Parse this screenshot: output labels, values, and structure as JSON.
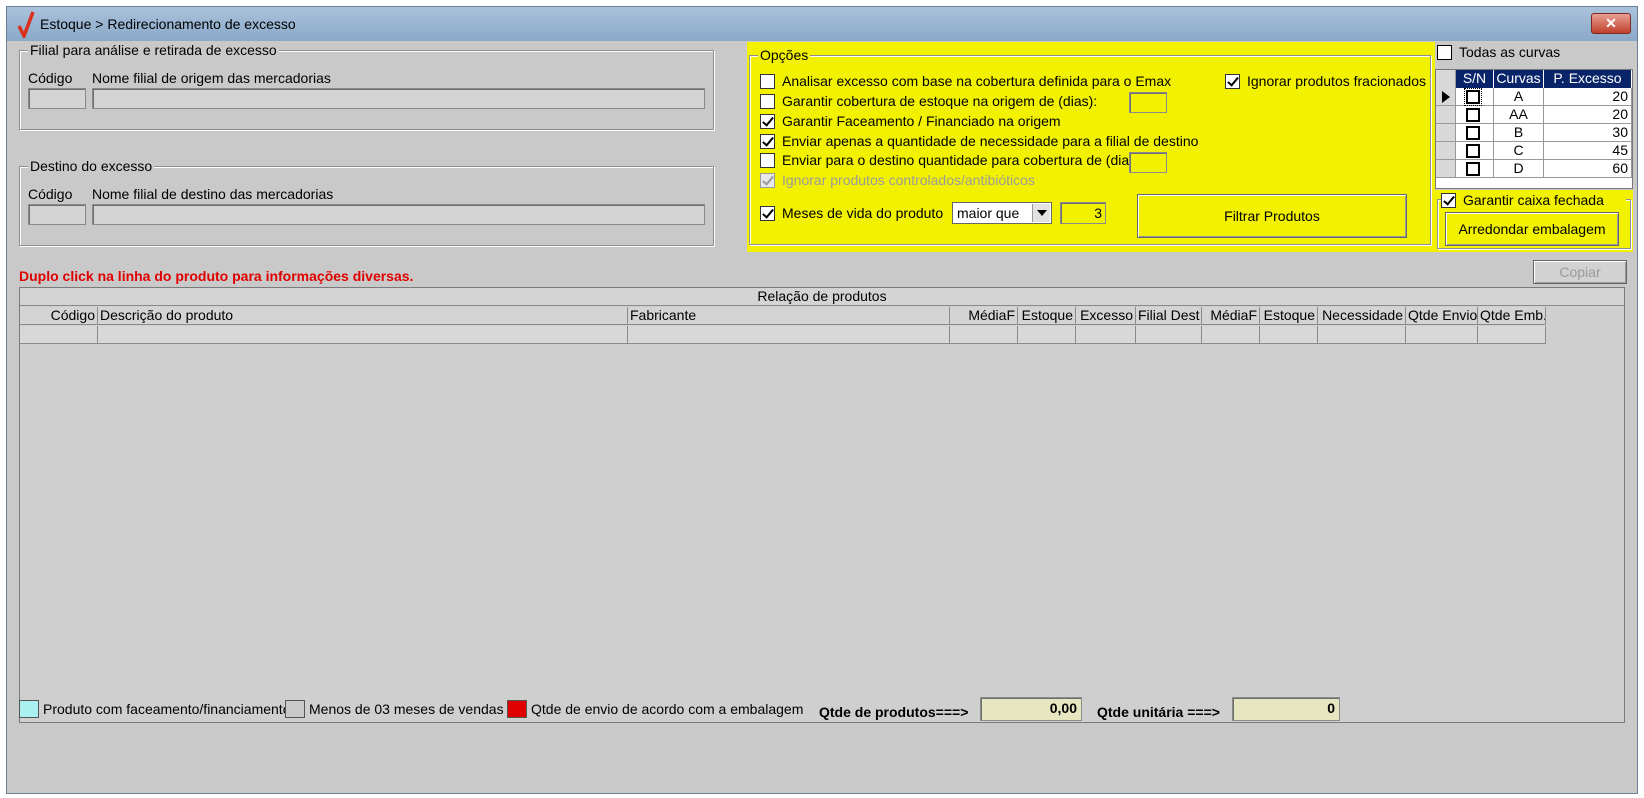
{
  "window": {
    "title": "Estoque > Redirecionamento de excesso",
    "close_glyph": "✕",
    "title_icon": "red-check-icon"
  },
  "origin": {
    "legend": "Filial para análise e retirada de excesso",
    "code_label": "Código",
    "name_label": "Nome filial de origem das mercadorias",
    "code_value": "",
    "name_value": ""
  },
  "destination": {
    "legend": "Destino do excesso",
    "code_label": "Código",
    "name_label": "Nome filial de destino das mercadorias",
    "code_value": "",
    "name_value": ""
  },
  "options": {
    "legend": "Opções",
    "analyze_emax": {
      "label": "Analisar excesso com base na cobertura definida para o Emax",
      "checked": false
    },
    "guarantee_origin": {
      "label": "Garantir cobertura de estoque na origem de (dias):",
      "checked": false,
      "value": ""
    },
    "guarantee_facing": {
      "label": "Garantir Faceamento / Financiado na origem",
      "checked": true
    },
    "send_needed_only": {
      "label": "Enviar apenas a quantidade de necessidade para a filial de destino",
      "checked": true
    },
    "send_coverage": {
      "label": "Enviar para o destino quantidade para cobertura de (dias):",
      "checked": false,
      "value": ""
    },
    "ignore_controlled": {
      "label": "Ignorar produtos controlados/antibióticos",
      "checked": true,
      "disabled": true
    },
    "ignore_fractioned": {
      "label": "Ignorar produtos fracionados",
      "checked": true
    },
    "shelf_life": {
      "label": "Meses de vida do produto",
      "checked": true,
      "operator": "maior que",
      "months": "3"
    },
    "filter_button": "Filtrar Produtos"
  },
  "curves": {
    "all_label": "Todas as curvas",
    "all_checked": false,
    "headers": [
      "S/N",
      "Curvas",
      "P. Excesso"
    ],
    "rows": [
      {
        "curve": "A",
        "excess": "20",
        "checked": false
      },
      {
        "curve": "AA",
        "excess": "20",
        "checked": false
      },
      {
        "curve": "B",
        "excess": "30",
        "checked": false
      },
      {
        "curve": "C",
        "excess": "45",
        "checked": false
      },
      {
        "curve": "D",
        "excess": "60",
        "checked": false
      }
    ]
  },
  "packaging": {
    "label": "Garantir caixa fechada",
    "checked": true,
    "round_button": "Arredondar embalagem"
  },
  "hint": "Duplo click na linha do produto para informações diversas.",
  "copy_button": "Copiar",
  "products": {
    "caption": "Relação de produtos",
    "columns": [
      "Código",
      "Descrição do produto",
      "Fabricante",
      "MédiaF",
      "Estoque",
      "Excesso",
      "Filial Dest",
      "MédiaF",
      "Estoque",
      "Necessidade",
      "Qtde Envio",
      "Qtde Emb."
    ]
  },
  "legend": {
    "facing": {
      "label": "Produto com faceamento/financiamento",
      "color": "#aaf0f0"
    },
    "less3": {
      "label": "Menos de 03 meses de vendas",
      "color": "#c9c9c9"
    },
    "packaging": {
      "label": "Qtde de envio de acordo com a embalagem",
      "color": "#e00000"
    }
  },
  "totals": {
    "products_label": "Qtde de produtos===>",
    "products_value": "0,00",
    "units_label": "Qtde unitária ===>",
    "units_value": "0"
  },
  "colors": {
    "options_bg": "#f2f200",
    "hint": "#e00000",
    "grid_header": "#0a246a"
  }
}
